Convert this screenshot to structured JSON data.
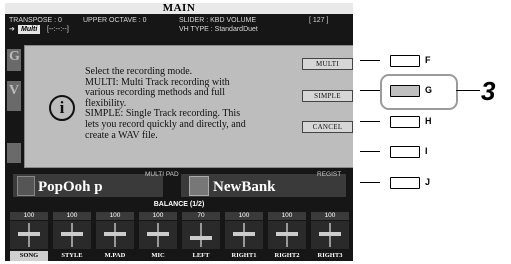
{
  "screen": {
    "title": "MAIN",
    "status": {
      "transpose": "TRANSPOSE : 0",
      "upper_octave": "UPPER OCTAVE : 0",
      "slider": "SLIDER : KBD VOLUME",
      "slider_value": "[ 127 ]",
      "mode": "Multi",
      "time": "[--:--:--]",
      "vh_type": "VH TYPE : StandardDuet"
    },
    "dialog": {
      "message_lines": [
        "Select the recording mode.",
        "MULTI: Multi Track recording with",
        "various recording methods and full",
        "flexibility.",
        "SIMPLE: Single Track recording. This",
        "lets you record quickly and directly, and",
        "create a WAV file."
      ],
      "buttons": {
        "multi": "MULTI",
        "simple": "SIMPLE",
        "cancel": "CANCEL"
      }
    },
    "lower": {
      "multipad_label": "MULTI PAD",
      "regist_label": "REGIST",
      "multipad_bank": "PopOoh p",
      "regist_bank": "NewBank",
      "balance_title": "BALANCE (1/2)",
      "volumes": [
        "100",
        "100",
        "100",
        "100",
        "70",
        "100",
        "100",
        "100"
      ],
      "channels": [
        "SONG",
        "STYLE",
        "M.PAD",
        "MIC",
        "LEFT",
        "RIGHT1",
        "RIGHT2",
        "RIGHT3"
      ]
    }
  },
  "panel": {
    "buttons": [
      "F",
      "G",
      "H",
      "I",
      "J"
    ],
    "callout": "3"
  }
}
